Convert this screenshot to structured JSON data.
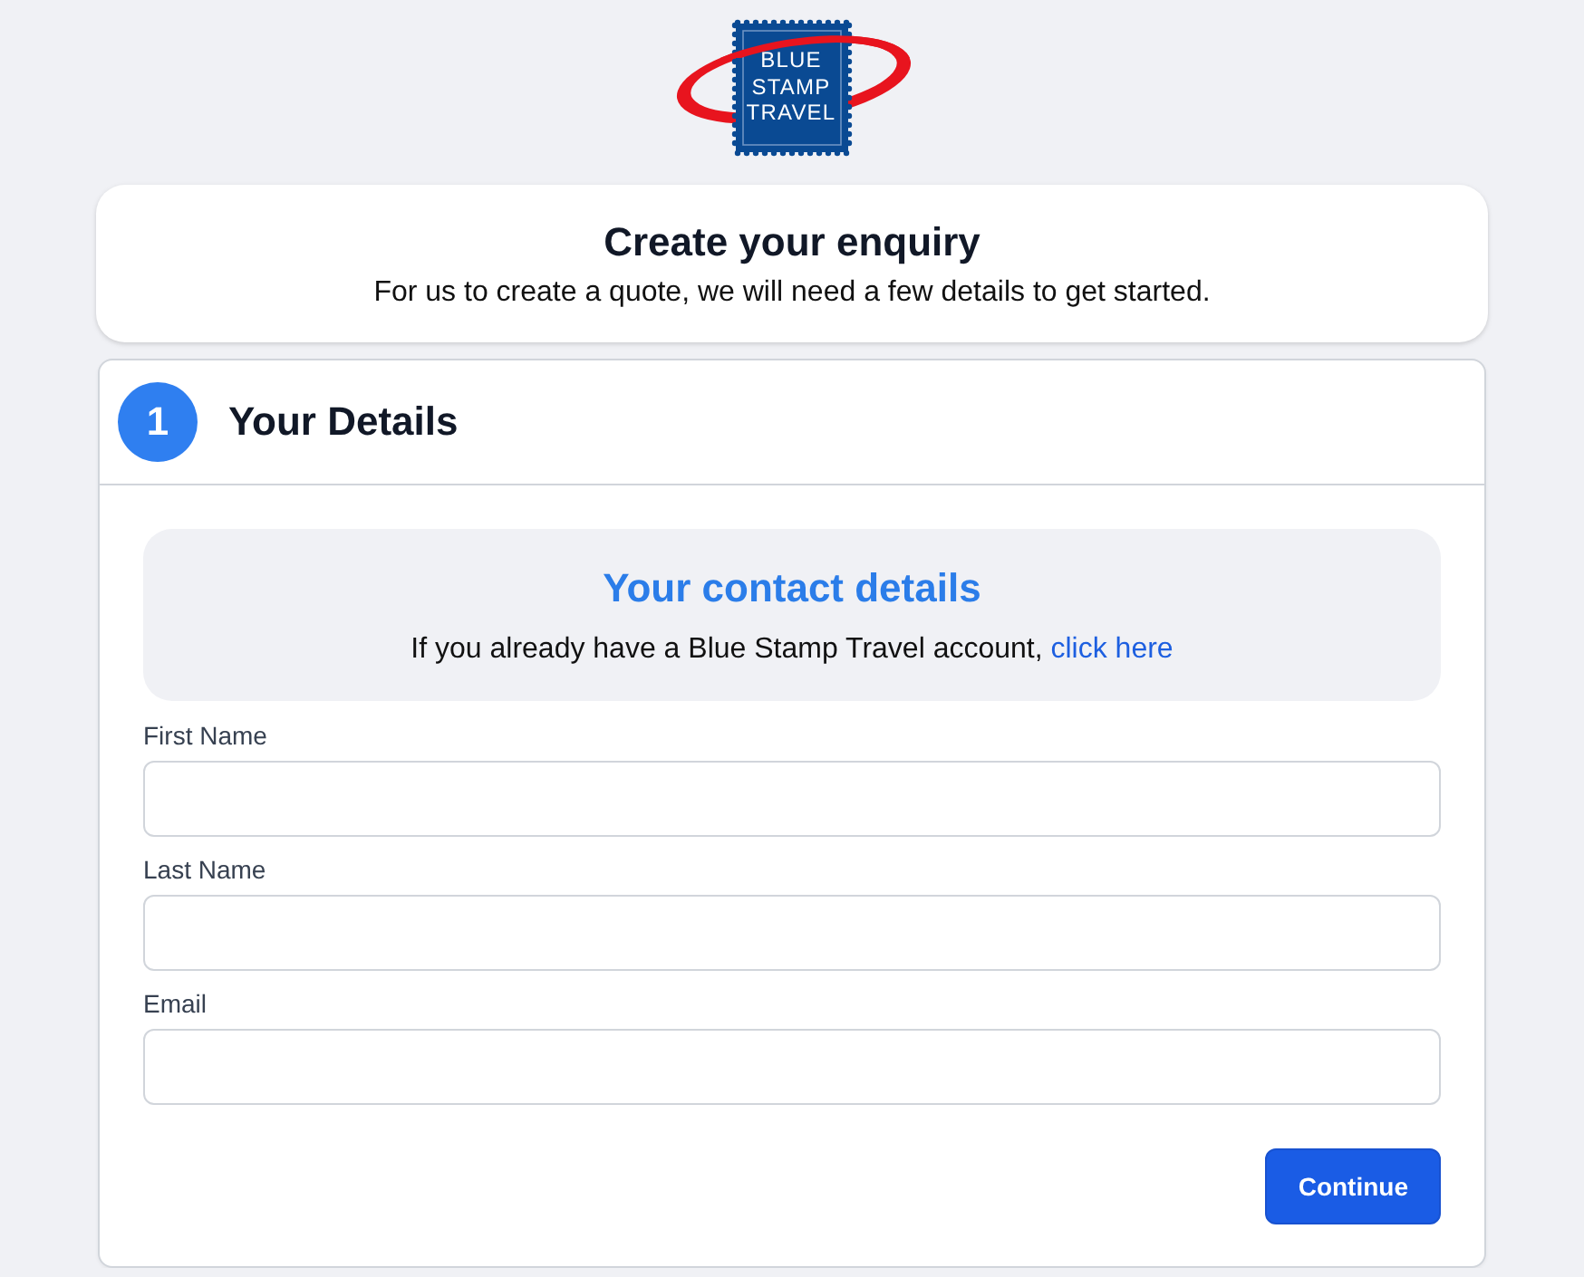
{
  "logo": {
    "lines": [
      "BLUE",
      "STAMP",
      "TRAVEL"
    ]
  },
  "intro": {
    "title": "Create your enquiry",
    "subtitle": "For us to create a quote, we will need a few details to get started."
  },
  "step": {
    "number": "1",
    "title": "Your Details"
  },
  "contact": {
    "title": "Your contact details",
    "text": "If you already have a Blue Stamp Travel account,",
    "link": "click here"
  },
  "fields": [
    {
      "label": "First Name"
    },
    {
      "label": "Last Name"
    },
    {
      "label": "Email"
    }
  ],
  "buttons": [
    {
      "label": "Continue"
    }
  ]
}
